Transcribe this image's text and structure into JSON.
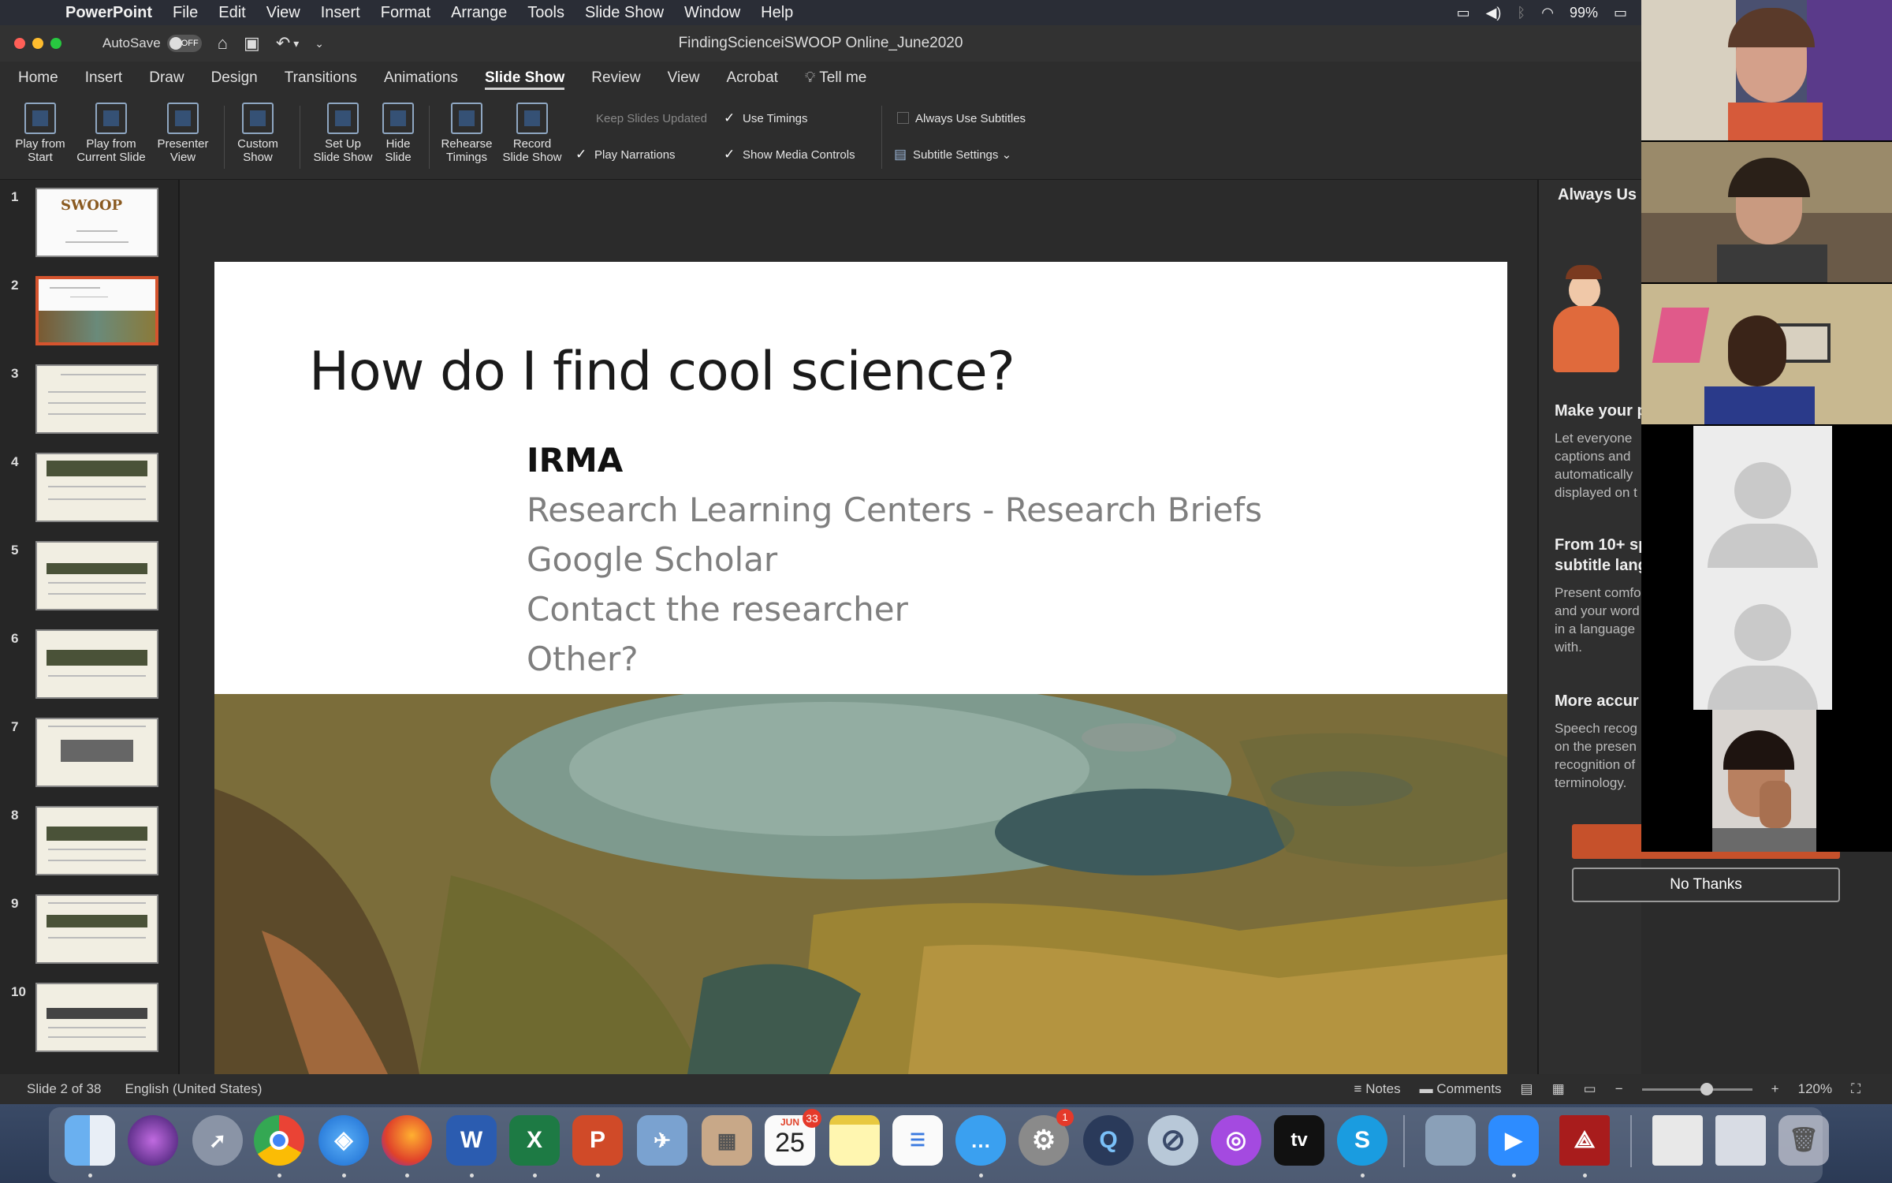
{
  "menubar": {
    "app": "PowerPoint",
    "items": [
      "File",
      "Edit",
      "View",
      "Insert",
      "Format",
      "Arrange",
      "Tools",
      "Slide Show",
      "Window",
      "Help"
    ],
    "battery": "99%"
  },
  "titlebar": {
    "autosave_label": "AutoSave",
    "autosave_state": "OFF",
    "document_title": "FindingScienceiSWOOP Online_June2020"
  },
  "ribbon_tabs": {
    "items": [
      "Home",
      "Insert",
      "Draw",
      "Design",
      "Transitions",
      "Animations",
      "Slide Show",
      "Review",
      "View",
      "Acrobat"
    ],
    "active": "Slide Show",
    "tell_me": "Tell me"
  },
  "ribbon": {
    "buttons": [
      {
        "l1": "Play from",
        "l2": "Start"
      },
      {
        "l1": "Play from",
        "l2": "Current Slide"
      },
      {
        "l1": "Presenter",
        "l2": "View"
      },
      {
        "l1": "Custom",
        "l2": "Show"
      },
      {
        "l1": "Set Up",
        "l2": "Slide Show"
      },
      {
        "l1": "Hide",
        "l2": "Slide"
      },
      {
        "l1": "Rehearse",
        "l2": "Timings"
      },
      {
        "l1": "Record",
        "l2": "Slide Show"
      }
    ],
    "keep_slides_updated": "Keep Slides Updated",
    "play_narrations": "Play Narrations",
    "use_timings": "Use Timings",
    "show_media_controls": "Show Media Controls",
    "always_use_subtitles": "Always Use Subtitles",
    "subtitle_settings": "Subtitle Settings"
  },
  "thumbnails": {
    "numbers": [
      "1",
      "2",
      "3",
      "4",
      "5",
      "6",
      "7",
      "8",
      "9",
      "10"
    ],
    "selected": "2"
  },
  "slide": {
    "title": "How do I find cool science?",
    "bullets": [
      "IRMA",
      "Research Learning Centers - Research Briefs",
      "Google Scholar",
      "Contact the researcher",
      "Other?"
    ]
  },
  "task_pane": {
    "heading": "Always Us",
    "make_your": "Make your p",
    "make_text": "Let everyone\ncaptions and\nautomatically\ndisplayed on t",
    "from10": "From 10+ sp\nsubtitle lang",
    "from10_text": "Present comfo\nand your word\nin a language\nwith.",
    "more_accur": "More accur",
    "more_text": "Speech recog\non the presen\nrecognition of\nterminology.",
    "no_thanks": "No Thanks"
  },
  "statusbar": {
    "slide_info": "Slide 2 of 38",
    "language": "English (United States)",
    "notes": "Notes",
    "comments": "Comments",
    "zoom": "120%"
  },
  "dock": {
    "calendar_month": "JUN",
    "calendar_day": "25",
    "calendar_badge": "33",
    "settings_badge": "1",
    "tv_label": "tv"
  }
}
